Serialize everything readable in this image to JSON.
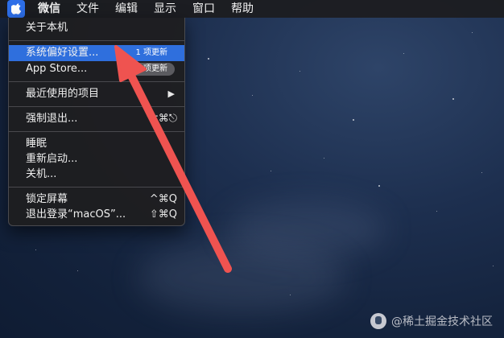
{
  "menubar": {
    "apple_icon": "apple-logo-icon",
    "items": [
      {
        "label": "微信"
      },
      {
        "label": "文件"
      },
      {
        "label": "编辑"
      },
      {
        "label": "显示"
      },
      {
        "label": "窗口"
      },
      {
        "label": "帮助"
      }
    ]
  },
  "apple_menu": {
    "about": "关于本机",
    "system_prefs": {
      "label": "系统偏好设置...",
      "badge": "1 项更新"
    },
    "app_store": {
      "label": "App Store...",
      "badge": "2 项更新"
    },
    "recent_items": {
      "label": "最近使用的项目",
      "arrow": "▶"
    },
    "force_quit": {
      "label": "强制退出...",
      "shortcut": "⌥⌘⎋"
    },
    "sleep": "睡眠",
    "restart": "重新启动...",
    "shutdown": "关机...",
    "lock_screen": {
      "label": "锁定屏幕",
      "shortcut": "^⌘Q"
    },
    "logout": {
      "label": "退出登录“macOS”...",
      "shortcut": "⇧⌘Q"
    }
  },
  "colors": {
    "highlight": "#2f6fdd",
    "arrow": "#ef5350",
    "menu_bg": "#1e1e20",
    "menubar_bg": "#1c1c1e"
  },
  "watermark": {
    "text": "@稀土掘金技术社区",
    "logo_icon": "juejin-logo-icon"
  }
}
